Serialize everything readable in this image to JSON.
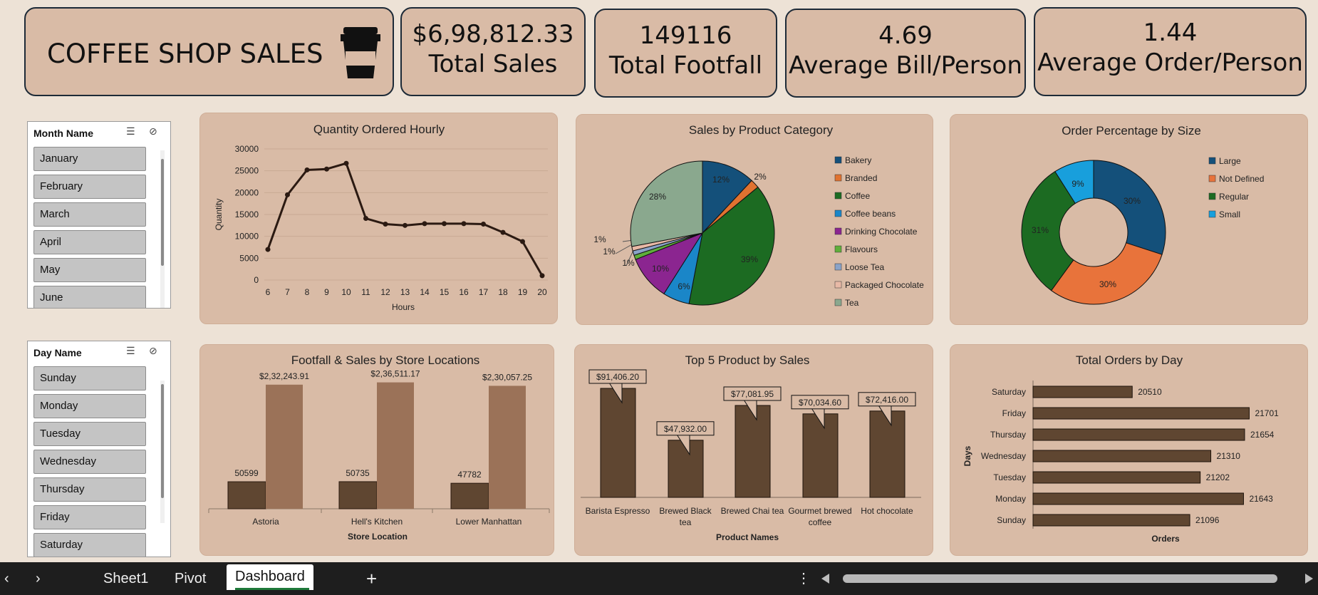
{
  "header": {
    "title": "COFFEE SHOP SALES",
    "icon": "coffee-cup-icon"
  },
  "kpis": [
    {
      "value": "$6,98,812.33",
      "label": "Total Sales"
    },
    {
      "value": "149116",
      "label": "Total Footfall"
    },
    {
      "value": "4.69",
      "label": "Average Bill/Person"
    },
    {
      "value": "1.44",
      "label": "Average Order/Person"
    }
  ],
  "slicers": {
    "month": {
      "header": "Month Name",
      "items": [
        "January",
        "February",
        "March",
        "April",
        "May",
        "June"
      ]
    },
    "day": {
      "header": "Day Name",
      "items": [
        "Sunday",
        "Monday",
        "Tuesday",
        "Wednesday",
        "Thursday",
        "Friday",
        "Saturday"
      ]
    }
  },
  "tabs": {
    "items": [
      "Sheet1",
      "Pivot",
      "Dashboard"
    ],
    "active": "Dashboard",
    "add": "+"
  },
  "colors": {
    "background": "#ede2d6",
    "card": "#d9bba6",
    "dark_brown": "#5f4631",
    "light_brown": "#9b7258",
    "line": "#2b1a12"
  },
  "chart_data": [
    {
      "id": "hourly",
      "type": "line",
      "title": "Quantity Ordered Hourly",
      "xlabel": "Hours",
      "ylabel": "Quantity",
      "x": [
        6,
        7,
        8,
        9,
        10,
        11,
        12,
        13,
        14,
        15,
        16,
        17,
        18,
        19,
        20
      ],
      "values": [
        7000,
        19500,
        25200,
        25400,
        26700,
        14100,
        12800,
        12500,
        12900,
        12900,
        12900,
        12800,
        10900,
        8800,
        1000
      ],
      "ylim": [
        0,
        30000
      ],
      "yticks": [
        0,
        5000,
        10000,
        15000,
        20000,
        25000,
        30000
      ],
      "grid": true
    },
    {
      "id": "category",
      "type": "pie",
      "title": "Sales by Product Category",
      "categories": [
        "Bakery",
        "Branded",
        "Coffee",
        "Coffee beans",
        "Drinking Chocolate",
        "Flavours",
        "Loose Tea",
        "Packaged Chocolate",
        "Tea"
      ],
      "values": [
        12,
        2,
        39,
        6,
        10,
        1,
        1,
        1,
        28
      ],
      "labels": [
        "12%",
        "2%",
        "39%",
        "6%",
        "10%",
        "1%",
        "1%",
        "1%",
        "28%"
      ],
      "colors": [
        "#14507a",
        "#e07230",
        "#1c6b22",
        "#1a86c8",
        "#8b2590",
        "#5fae3b",
        "#8aa3c8",
        "#e8b9a6",
        "#8aa88e"
      ],
      "legend": "right"
    },
    {
      "id": "size",
      "type": "pie",
      "title": "Order Percentage by Size",
      "categories": [
        "Large",
        "Not Defined",
        "Regular",
        "Small"
      ],
      "values": [
        30,
        30,
        31,
        9
      ],
      "labels": [
        "30%",
        "30%",
        "31%",
        "9%"
      ],
      "colors": [
        "#14507a",
        "#e8733b",
        "#1c6b22",
        "#189fdc"
      ],
      "donut": true,
      "legend": "right"
    },
    {
      "id": "stores",
      "type": "bar",
      "title": "Footfall & Sales by Store Locations",
      "xlabel": "Store Location",
      "categories": [
        "Astoria",
        "Hell's Kitchen",
        "Lower Manhattan"
      ],
      "series": [
        {
          "values": [
            50599,
            50735,
            47782
          ],
          "labels": [
            "50599",
            "50735",
            "47782"
          ],
          "color": "#5f4631"
        },
        {
          "values": [
            232243.91,
            236511.17,
            230057.25
          ],
          "labels": [
            "$2,32,243.91",
            "$2,36,511.17",
            "$2,30,057.25"
          ],
          "color": "#9b7258"
        }
      ]
    },
    {
      "id": "top5",
      "type": "bar",
      "title": "Top 5 Product by Sales",
      "xlabel": "Product Names",
      "categories": [
        "Barista Espresso",
        "Brewed Black tea",
        "Brewed Chai tea",
        "Gourmet brewed coffee",
        "Hot chocolate"
      ],
      "values": [
        91406.2,
        47932.0,
        77081.95,
        70034.6,
        72416.0
      ],
      "labels": [
        "$91,406.20",
        "$47,932.00",
        "$77,081.95",
        "$70,034.60",
        "$72,416.00"
      ],
      "ylim": [
        0,
        95000
      ]
    },
    {
      "id": "days",
      "type": "bar",
      "orientation": "horizontal",
      "title": "Total Orders by Day",
      "xlabel": "Orders",
      "ylabel": "Days",
      "categories": [
        "Saturday",
        "Friday",
        "Thursday",
        "Wednesday",
        "Tuesday",
        "Monday",
        "Sunday"
      ],
      "values": [
        20510,
        21701,
        21654,
        21310,
        21202,
        21643,
        21096
      ],
      "xlim": [
        19500,
        21850
      ]
    }
  ]
}
